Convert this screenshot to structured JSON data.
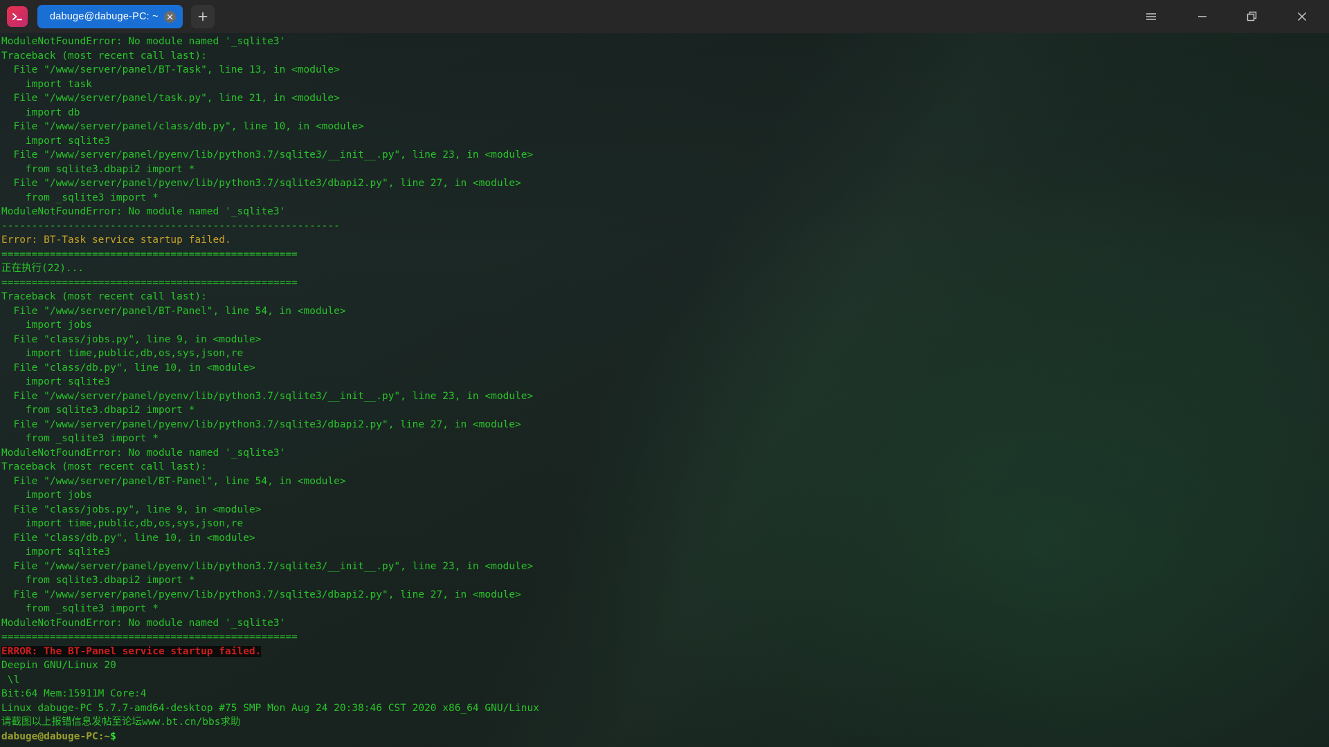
{
  "window": {
    "app_icon": "terminal-icon",
    "menu_icon": "hamburger-menu-icon",
    "minimize_icon": "minimize-icon",
    "maximize_icon": "maximize-icon",
    "close_icon": "close-icon"
  },
  "tabs": {
    "new_tab_icon": "plus-icon",
    "close_tab_icon": "close-icon",
    "items": [
      {
        "label": "dabuge@dabuge-PC: ~",
        "active": true
      }
    ]
  },
  "colors": {
    "accent": "#1a6fd4",
    "titlebar": "#272727",
    "terminal_green": "#29c329",
    "error_red": "#d01d1d",
    "warn_yellow": "#c9a227",
    "prompt_olive": "#9aa12a"
  },
  "terminal": {
    "lines": [
      {
        "text": "ModuleNotFoundError: No module named '_sqlite3'",
        "class": "c-green"
      },
      {
        "text": "Traceback (most recent call last):",
        "class": "c-green"
      },
      {
        "text": "  File \"/www/server/panel/BT-Task\", line 13, in <module>",
        "class": "c-green"
      },
      {
        "text": "    import task",
        "class": "c-green"
      },
      {
        "text": "  File \"/www/server/panel/task.py\", line 21, in <module>",
        "class": "c-green"
      },
      {
        "text": "    import db",
        "class": "c-green"
      },
      {
        "text": "  File \"/www/server/panel/class/db.py\", line 10, in <module>",
        "class": "c-green"
      },
      {
        "text": "    import sqlite3",
        "class": "c-green"
      },
      {
        "text": "  File \"/www/server/panel/pyenv/lib/python3.7/sqlite3/__init__.py\", line 23, in <module>",
        "class": "c-green"
      },
      {
        "text": "    from sqlite3.dbapi2 import *",
        "class": "c-green"
      },
      {
        "text": "  File \"/www/server/panel/pyenv/lib/python3.7/sqlite3/dbapi2.py\", line 27, in <module>",
        "class": "c-green"
      },
      {
        "text": "    from _sqlite3 import *",
        "class": "c-green"
      },
      {
        "text": "ModuleNotFoundError: No module named '_sqlite3'",
        "class": "c-green"
      },
      {
        "text": "--------------------------------------------------------",
        "class": "c-green"
      },
      {
        "text": "Error: BT-Task service startup failed.",
        "class": "c-yellow"
      },
      {
        "text": "=================================================",
        "class": "c-green"
      },
      {
        "text": "正在执行(22)...",
        "class": "c-green"
      },
      {
        "text": "=================================================",
        "class": "c-green"
      },
      {
        "text": "Traceback (most recent call last):",
        "class": "c-green"
      },
      {
        "text": "  File \"/www/server/panel/BT-Panel\", line 54, in <module>",
        "class": "c-green"
      },
      {
        "text": "    import jobs",
        "class": "c-green"
      },
      {
        "text": "  File \"class/jobs.py\", line 9, in <module>",
        "class": "c-green"
      },
      {
        "text": "    import time,public,db,os,sys,json,re",
        "class": "c-green"
      },
      {
        "text": "  File \"class/db.py\", line 10, in <module>",
        "class": "c-green"
      },
      {
        "text": "    import sqlite3",
        "class": "c-green"
      },
      {
        "text": "  File \"/www/server/panel/pyenv/lib/python3.7/sqlite3/__init__.py\", line 23, in <module>",
        "class": "c-green"
      },
      {
        "text": "    from sqlite3.dbapi2 import *",
        "class": "c-green"
      },
      {
        "text": "  File \"/www/server/panel/pyenv/lib/python3.7/sqlite3/dbapi2.py\", line 27, in <module>",
        "class": "c-green"
      },
      {
        "text": "    from _sqlite3 import *",
        "class": "c-green"
      },
      {
        "text": "ModuleNotFoundError: No module named '_sqlite3'",
        "class": "c-green"
      },
      {
        "text": "Traceback (most recent call last):",
        "class": "c-green"
      },
      {
        "text": "  File \"/www/server/panel/BT-Panel\", line 54, in <module>",
        "class": "c-green"
      },
      {
        "text": "    import jobs",
        "class": "c-green"
      },
      {
        "text": "  File \"class/jobs.py\", line 9, in <module>",
        "class": "c-green"
      },
      {
        "text": "    import time,public,db,os,sys,json,re",
        "class": "c-green"
      },
      {
        "text": "  File \"class/db.py\", line 10, in <module>",
        "class": "c-green"
      },
      {
        "text": "    import sqlite3",
        "class": "c-green"
      },
      {
        "text": "  File \"/www/server/panel/pyenv/lib/python3.7/sqlite3/__init__.py\", line 23, in <module>",
        "class": "c-green"
      },
      {
        "text": "    from sqlite3.dbapi2 import *",
        "class": "c-green"
      },
      {
        "text": "  File \"/www/server/panel/pyenv/lib/python3.7/sqlite3/dbapi2.py\", line 27, in <module>",
        "class": "c-green"
      },
      {
        "text": "    from _sqlite3 import *",
        "class": "c-green"
      },
      {
        "text": "ModuleNotFoundError: No module named '_sqlite3'",
        "class": "c-green"
      },
      {
        "text": "=================================================",
        "class": "c-green"
      },
      {
        "text": "ERROR: The BT-Panel service startup failed.",
        "class": "c-red",
        "highlight": true
      },
      {
        "text": "Deepin GNU/Linux 20",
        "class": "c-green"
      },
      {
        "text": " \\l",
        "class": "c-green"
      },
      {
        "text": "Bit:64 Mem:15911M Core:4",
        "class": "c-green"
      },
      {
        "text": "Linux dabuge-PC 5.7.7-amd64-desktop #75 SMP Mon Aug 24 20:38:46 CST 2020 x86_64 GNU/Linux",
        "class": "c-green"
      },
      {
        "text": "请截图以上报错信息发帖至论坛www.bt.cn/bbs求助",
        "class": "c-green"
      }
    ],
    "prompt": {
      "user_host": "dabuge@dabuge-PC",
      "colon": ":",
      "path": "~",
      "symbol": "$"
    }
  }
}
